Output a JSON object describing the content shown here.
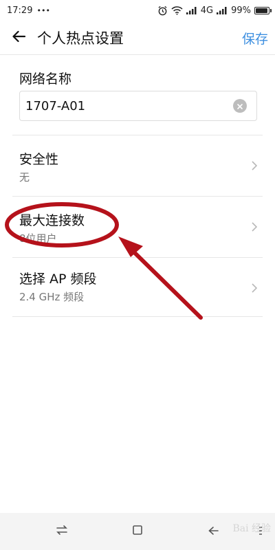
{
  "status_bar": {
    "time": "17:29",
    "dots": "•••",
    "network": "4G",
    "battery_percent": "99%",
    "battery_level": 0.99,
    "icons": [
      "alarm-icon",
      "wifi-icon",
      "signal-icon",
      "battery-icon"
    ]
  },
  "header": {
    "back_icon": "arrow-left-icon",
    "title": "个人热点设置",
    "save_label": "保存",
    "accent_color": "#3d8fe0"
  },
  "ssid": {
    "label": "网络名称",
    "value": "1707-A01",
    "clear_icon": "clear-icon"
  },
  "settings": [
    {
      "title": "安全性",
      "subtitle": "无"
    },
    {
      "title": "最大连接数",
      "subtitle": "8位用户"
    },
    {
      "title": "选择 AP 频段",
      "subtitle": "2.4 GHz 频段"
    }
  ],
  "annotation": {
    "color": "#b5121b"
  },
  "nav_bar": {
    "icons": [
      "swap-icon",
      "recents-square-icon",
      "back-nav-icon",
      "menu-icon"
    ]
  },
  "watermark": "Bai 经验"
}
